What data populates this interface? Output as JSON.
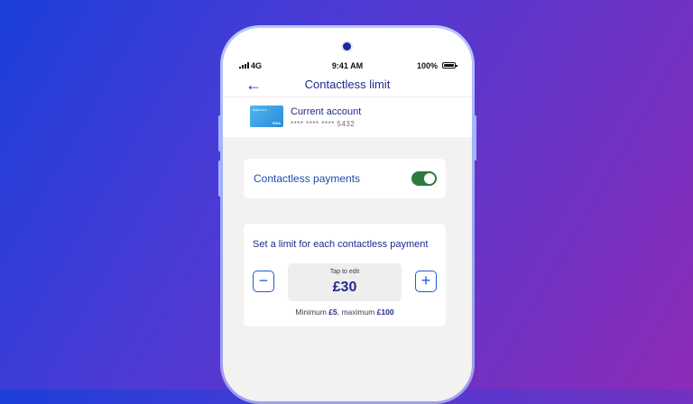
{
  "status": {
    "network": "4G",
    "time": "9:41 AM",
    "battery": "100%"
  },
  "header": {
    "back_icon": "←",
    "title": "Contactless limit"
  },
  "account": {
    "card_bank": "BARCLAYS",
    "card_brand": "VISA",
    "name": "Current account",
    "number": "**** **** **** 5432"
  },
  "contactless": {
    "label": "Contactless payments",
    "enabled": true
  },
  "limit": {
    "label": "Set a limit for each contactless payment",
    "minus_label": "−",
    "plus_label": "+",
    "tap_hint": "Tap to edit",
    "amount": "£30",
    "min_prefix": "Minimum ",
    "min": "£5",
    "max_prefix": ", maximum ",
    "max": "£100"
  },
  "colors": {
    "accent": "#1e2a8c",
    "toggle_on": "#2d7a3e",
    "card": "#2a8ad7"
  }
}
